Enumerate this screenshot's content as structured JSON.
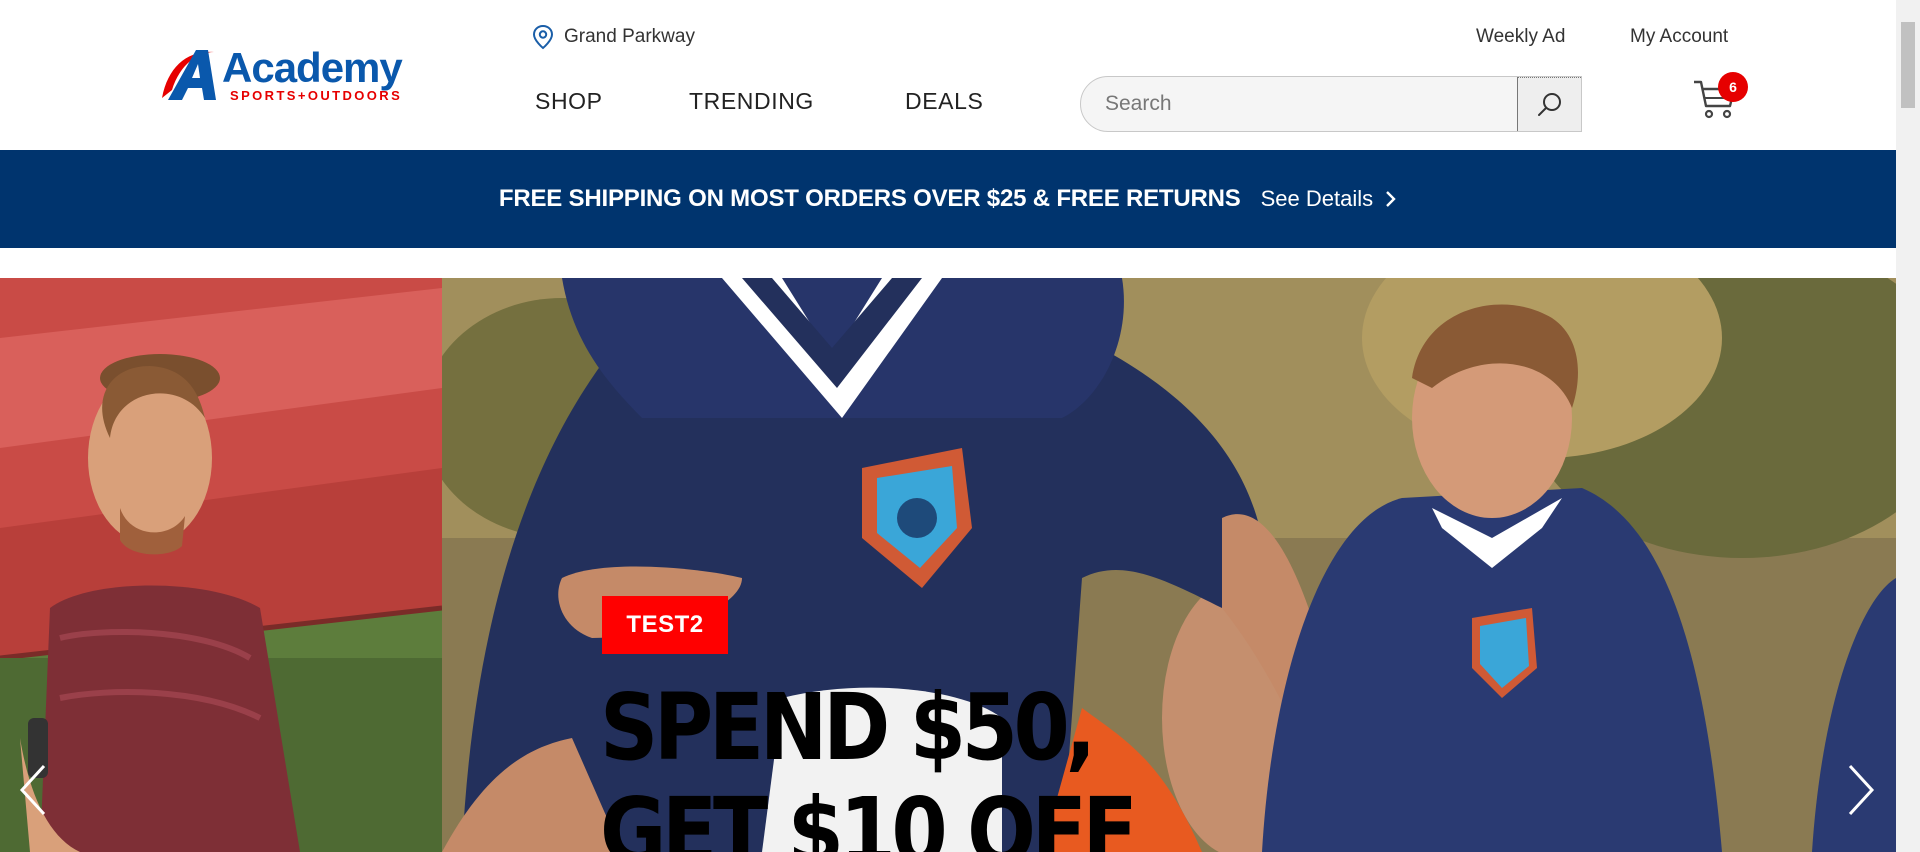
{
  "brand": {
    "logo_name": "Academy",
    "logo_tagline": "SPORTS+OUTDOORS",
    "colors": {
      "blue": "#00346e",
      "red": "#e60000",
      "logo_blue": "#0a58ac"
    }
  },
  "header": {
    "location_label": "Grand Parkway",
    "weekly_ad": "Weekly Ad",
    "my_account": "My Account",
    "nav": [
      "SHOP",
      "TRENDING",
      "DEALS"
    ],
    "search_placeholder": "Search",
    "cart_count": "6"
  },
  "banner": {
    "text": "FREE SHIPPING ON MOST ORDERS OVER $25 & FREE RETURNS",
    "link": "See Details"
  },
  "hero": {
    "tag": "TEST2",
    "headline": "SPEND $50, GET $10 OFF"
  },
  "icons": [
    "location-pin-icon",
    "search-icon",
    "cart-icon",
    "chevron-right-icon",
    "carousel-prev-icon",
    "carousel-next-icon"
  ]
}
